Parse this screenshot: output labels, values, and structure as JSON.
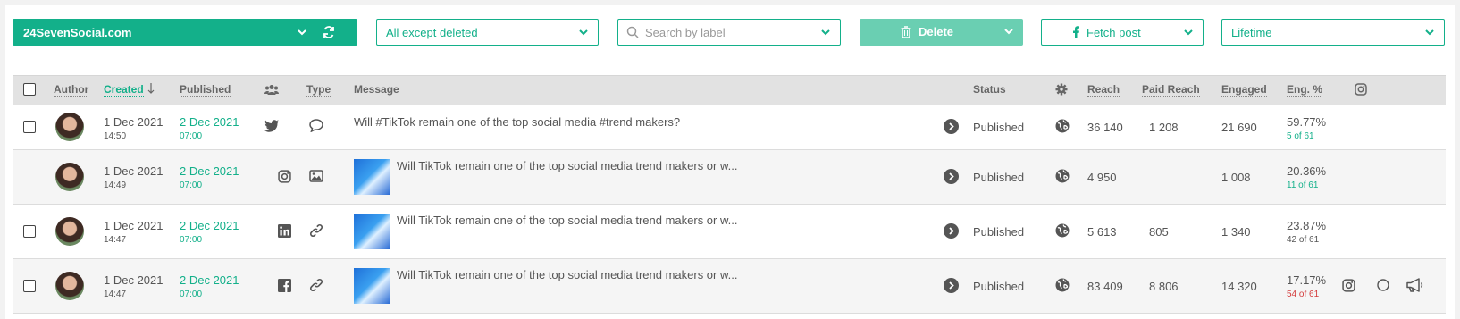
{
  "toolbar": {
    "account": "24SevenSocial.com",
    "filter": "All except deleted",
    "search_placeholder": "Search by label",
    "delete_label": "Delete",
    "fetch_label": "Fetch post",
    "period": "Lifetime"
  },
  "table": {
    "headers": {
      "author": "Author",
      "created": "Created",
      "published": "Published",
      "type": "Type",
      "message": "Message",
      "status": "Status",
      "reach": "Reach",
      "paid_reach": "Paid Reach",
      "engaged": "Engaged",
      "eng_pct": "Eng. %"
    },
    "rows": [
      {
        "created_date": "1 Dec 2021",
        "created_time": "14:50",
        "published_date": "2 Dec 2021",
        "published_time": "07:00",
        "network": "twitter-icon",
        "type": "comment-icon",
        "message": "Will #TikTok remain one of the top social media #trend makers?",
        "status": "Published",
        "reach": "36 140",
        "paid_reach": "1 208",
        "engaged": "21 690",
        "eng_pct": "59.77%",
        "rank": "5 of 61"
      },
      {
        "created_date": "1 Dec 2021",
        "created_time": "14:49",
        "published_date": "2 Dec 2021",
        "published_time": "07:00",
        "network": "instagram-icon",
        "type": "image-icon",
        "message": "Will TikTok remain one of the top social media trend makers or w...",
        "status": "Published",
        "reach": "4 950",
        "paid_reach": "",
        "engaged": "1 008",
        "eng_pct": "20.36%",
        "rank": "11 of 61"
      },
      {
        "created_date": "1 Dec 2021",
        "created_time": "14:47",
        "published_date": "2 Dec 2021",
        "published_time": "07:00",
        "network": "linkedin-icon",
        "type": "link-icon",
        "message": "Will TikTok remain one of the top social media trend makers or w...",
        "status": "Published",
        "reach": "5 613",
        "paid_reach": "805",
        "engaged": "1 340",
        "eng_pct": "23.87%",
        "rank": "42 of 61"
      },
      {
        "created_date": "1 Dec 2021",
        "created_time": "14:47",
        "published_date": "2 Dec 2021",
        "published_time": "07:00",
        "network": "facebook-icon",
        "type": "link-icon",
        "message": "Will TikTok remain one of the top social media trend makers or w...",
        "status": "Published",
        "reach": "83 409",
        "paid_reach": "8 806",
        "engaged": "14 320",
        "eng_pct": "17.17%",
        "rank": "54 of 61"
      }
    ]
  },
  "colors": {
    "accent": "#13b08a",
    "accent_light": "#6acfb2",
    "rank_bad": "#d43b3b",
    "header_bg": "#e2e2e2"
  }
}
